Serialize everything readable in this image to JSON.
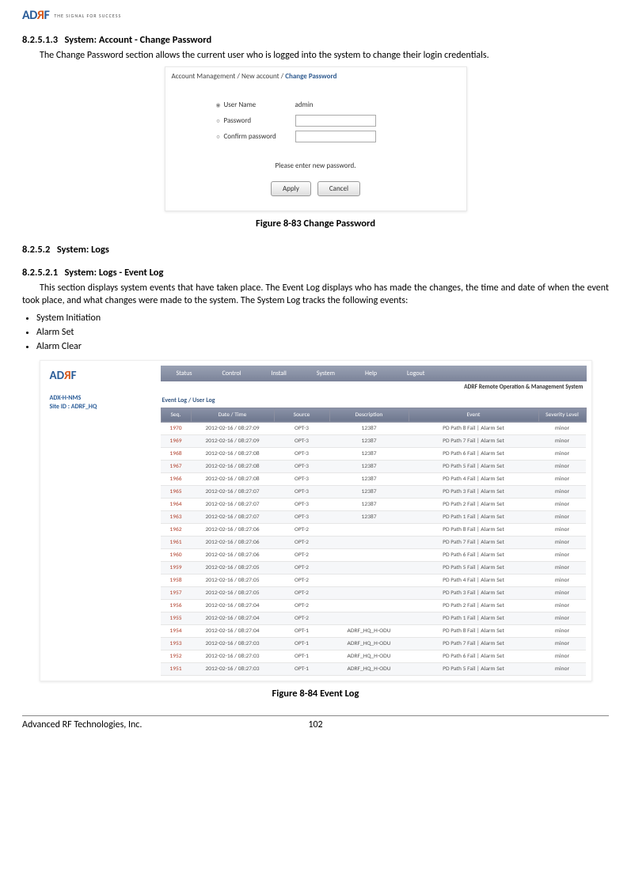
{
  "logo": {
    "tagline": "THE SIGNAL FOR SUCCESS"
  },
  "sec1": {
    "num": "8.2.5.1.3",
    "title": "System: Account - Change Password",
    "text": "The Change Password section allows the current user who is logged into the system to change their login credentials."
  },
  "fig1": {
    "breadcrumb": {
      "a": "Account Management",
      "b": "New account",
      "c": "Change Password"
    },
    "rows": {
      "username_label": "User Name",
      "username_value": "admin",
      "password_label": "Password",
      "confirm_label": "Confirm password"
    },
    "message": "Please enter new password.",
    "apply": "Apply",
    "cancel": "Cancel",
    "caption": "Figure 8-83    Change Password"
  },
  "sec2": {
    "num": "8.2.5.2",
    "title": "System: Logs"
  },
  "sec3": {
    "num": "8.2.5.2.1",
    "title": "System: Logs - Event Log",
    "text": "This section displays system events that have taken place. The Event Log displays who has made the changes, the time and date of when the event took place, and what changes were made to the system. The System Log tracks the following events:",
    "bullets": [
      "System Initiation",
      "Alarm Set",
      "Alarm Clear"
    ]
  },
  "fig2": {
    "site_line1": "ADX-H-NMS",
    "site_line2": "Site ID : ADRF_HQ",
    "menu": [
      "Status",
      "Control",
      "Install",
      "System",
      "Help",
      "Logout"
    ],
    "tagline": "ADRF Remote Operation & Management System",
    "breadcrumb": "Event Log / User Log",
    "headers": [
      "Seq.",
      "Date / Time",
      "Source",
      "Description",
      "Event",
      "Severity Level"
    ],
    "rows": [
      {
        "seq": "1970",
        "dt": "2012-02-16 / 08:27:09",
        "src": "OPT-3",
        "desc": "12387",
        "evt": "PD Path 8 Fail | Alarm Set",
        "sev": "minor"
      },
      {
        "seq": "1969",
        "dt": "2012-02-16 / 08:27:09",
        "src": "OPT-3",
        "desc": "12387",
        "evt": "PD Path 7 Fail | Alarm Set",
        "sev": "minor"
      },
      {
        "seq": "1968",
        "dt": "2012-02-16 / 08:27:08",
        "src": "OPT-3",
        "desc": "12387",
        "evt": "PD Path 6 Fail | Alarm Set",
        "sev": "minor"
      },
      {
        "seq": "1967",
        "dt": "2012-02-16 / 08:27:08",
        "src": "OPT-3",
        "desc": "12387",
        "evt": "PD Path 5 Fail | Alarm Set",
        "sev": "minor"
      },
      {
        "seq": "1966",
        "dt": "2012-02-16 / 08:27:08",
        "src": "OPT-3",
        "desc": "12387",
        "evt": "PD Path 4 Fail | Alarm Set",
        "sev": "minor"
      },
      {
        "seq": "1965",
        "dt": "2012-02-16 / 08:27:07",
        "src": "OPT-3",
        "desc": "12387",
        "evt": "PD Path 3 Fail | Alarm Set",
        "sev": "minor"
      },
      {
        "seq": "1964",
        "dt": "2012-02-16 / 08:27:07",
        "src": "OPT-3",
        "desc": "12387",
        "evt": "PD Path 2 Fail | Alarm Set",
        "sev": "minor"
      },
      {
        "seq": "1963",
        "dt": "2012-02-16 / 08:27:07",
        "src": "OPT-3",
        "desc": "12387",
        "evt": "PD Path 1 Fail | Alarm Set",
        "sev": "minor"
      },
      {
        "seq": "1962",
        "dt": "2012-02-16 / 08:27:06",
        "src": "OPT-2",
        "desc": "",
        "evt": "PD Path 8 Fail | Alarm Set",
        "sev": "minor"
      },
      {
        "seq": "1961",
        "dt": "2012-02-16 / 08:27:06",
        "src": "OPT-2",
        "desc": "",
        "evt": "PD Path 7 Fail | Alarm Set",
        "sev": "minor"
      },
      {
        "seq": "1960",
        "dt": "2012-02-16 / 08:27:06",
        "src": "OPT-2",
        "desc": "",
        "evt": "PD Path 6 Fail | Alarm Set",
        "sev": "minor"
      },
      {
        "seq": "1959",
        "dt": "2012-02-16 / 08:27:05",
        "src": "OPT-2",
        "desc": "",
        "evt": "PD Path 5 Fail | Alarm Set",
        "sev": "minor"
      },
      {
        "seq": "1958",
        "dt": "2012-02-16 / 08:27:05",
        "src": "OPT-2",
        "desc": "",
        "evt": "PD Path 4 Fail | Alarm Set",
        "sev": "minor"
      },
      {
        "seq": "1957",
        "dt": "2012-02-16 / 08:27:05",
        "src": "OPT-2",
        "desc": "",
        "evt": "PD Path 3 Fail | Alarm Set",
        "sev": "minor"
      },
      {
        "seq": "1956",
        "dt": "2012-02-16 / 08:27:04",
        "src": "OPT-2",
        "desc": "",
        "evt": "PD Path 2 Fail | Alarm Set",
        "sev": "minor"
      },
      {
        "seq": "1955",
        "dt": "2012-02-16 / 08:27:04",
        "src": "OPT-2",
        "desc": "",
        "evt": "PD Path 1 Fail | Alarm Set",
        "sev": "minor"
      },
      {
        "seq": "1954",
        "dt": "2012-02-16 / 08:27:04",
        "src": "OPT-1",
        "desc": "ADRF_HQ_H-ODU",
        "evt": "PD Path 8 Fail | Alarm Set",
        "sev": "minor"
      },
      {
        "seq": "1953",
        "dt": "2012-02-16 / 08:27:03",
        "src": "OPT-1",
        "desc": "ADRF_HQ_H-ODU",
        "evt": "PD Path 7 Fail | Alarm Set",
        "sev": "minor"
      },
      {
        "seq": "1952",
        "dt": "2012-02-16 / 08:27:03",
        "src": "OPT-1",
        "desc": "ADRF_HQ_H-ODU",
        "evt": "PD Path 6 Fail | Alarm Set",
        "sev": "minor"
      },
      {
        "seq": "1951",
        "dt": "2012-02-16 / 08:27:03",
        "src": "OPT-1",
        "desc": "ADRF_HQ_H-ODU",
        "evt": "PD Path 5 Fail | Alarm Set",
        "sev": "minor"
      }
    ],
    "caption": "Figure 8-84    Event Log"
  },
  "footer": {
    "left": "Advanced RF Technologies, Inc.",
    "center": "102"
  }
}
